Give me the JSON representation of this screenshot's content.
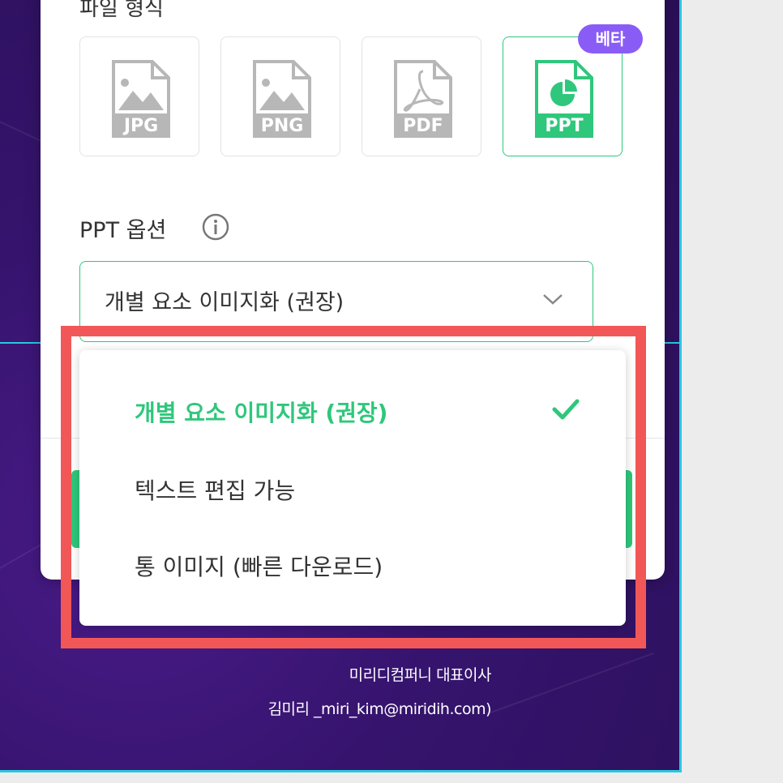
{
  "export": {
    "section_title": "파일 형식",
    "formats": [
      {
        "label": "JPG"
      },
      {
        "label": "PNG"
      },
      {
        "label": "PDF"
      },
      {
        "label": "PPT",
        "selected": true
      }
    ],
    "beta_badge": "베타",
    "ppt_options_label": "PPT 옵션",
    "selected_option": "개별 요소 이미지화 (권장)",
    "dropdown_options": [
      {
        "label": "개별 요소 이미지화 (권장)",
        "selected": true
      },
      {
        "label": "텍스트 편집 가능"
      },
      {
        "label": "통 이미지 (빠른 다운로드)"
      }
    ]
  },
  "canvas_footer": {
    "line1": "미리디컴퍼니 대표이사",
    "line2": "김미리 _miri_kim@miridih.com)"
  },
  "colors": {
    "accent_green": "#2fc77b",
    "beta_purple": "#8a5cf6",
    "highlight_red": "#f25757",
    "guide_cyan": "#29c7e0",
    "canvas_purple": "#36146e"
  }
}
